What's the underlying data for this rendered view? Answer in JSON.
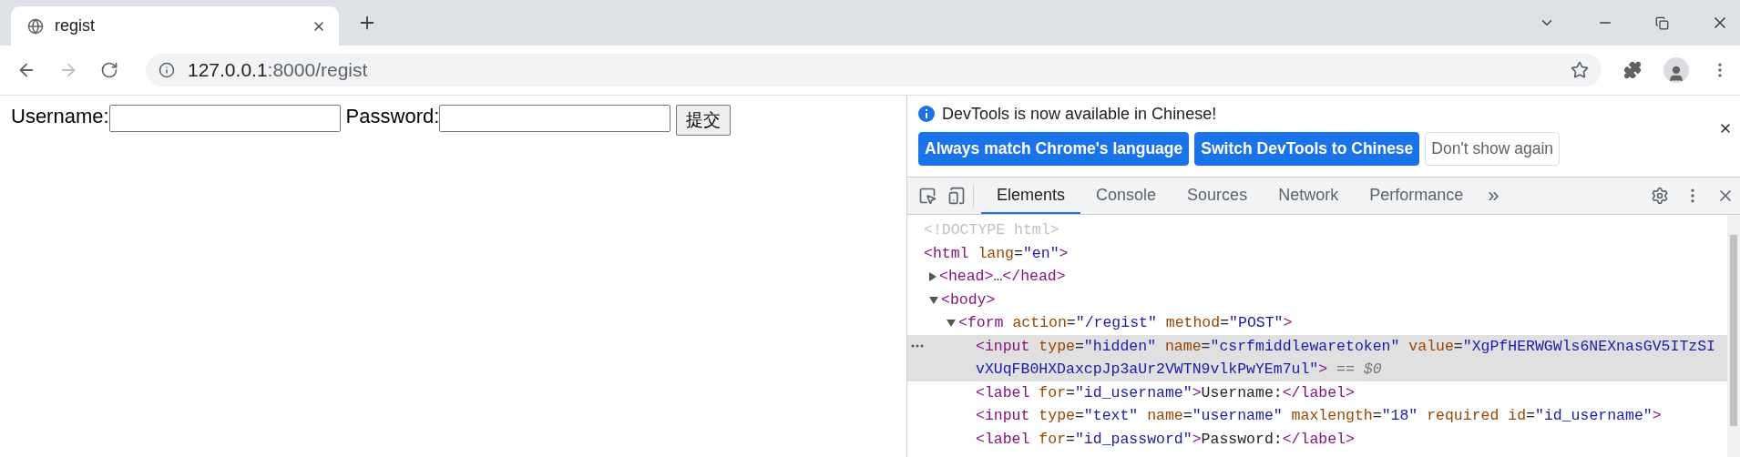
{
  "browser": {
    "tab": {
      "title": "regist"
    },
    "address": {
      "host": "127.0.0.1",
      "rest": ":8000/regist"
    },
    "forward_disabled": true
  },
  "page": {
    "fields": [
      {
        "label": "Username:"
      },
      {
        "label": "Password:"
      }
    ],
    "submit": "提交"
  },
  "devtools": {
    "infobar": {
      "message": "DevTools is now available in Chinese!",
      "buttons": [
        {
          "label": "Always match Chrome's language",
          "kind": "primary"
        },
        {
          "label": "Switch DevTools to Chinese",
          "kind": "primary"
        },
        {
          "label": "Don't show again",
          "kind": "secondary"
        }
      ]
    },
    "tabs": [
      {
        "label": "Elements",
        "selected": true
      },
      {
        "label": "Console",
        "selected": false
      },
      {
        "label": "Sources",
        "selected": false
      },
      {
        "label": "Network",
        "selected": false
      },
      {
        "label": "Performance",
        "selected": false
      }
    ],
    "more_tabs": "»",
    "dom": [
      {
        "selected": false,
        "segments": [
          {
            "kind": "doctype",
            "t": "<!DOCTYPE html>"
          }
        ]
      },
      {
        "selected": false,
        "segments": [
          {
            "kind": "tag",
            "t": "<html"
          },
          {
            "kind": "attr",
            "t": " lang"
          },
          {
            "kind": "plain",
            "t": "="
          },
          {
            "kind": "value",
            "t": "\"en\""
          },
          {
            "kind": "tag",
            "t": ">"
          }
        ],
        "children": [
          {
            "selected": false,
            "expanded": false,
            "segments": [
              {
                "kind": "tag",
                "t": "<head>"
              },
              {
                "kind": "plain",
                "t": "…"
              },
              {
                "kind": "tag",
                "t": "</head>"
              }
            ]
          },
          {
            "selected": false,
            "expanded": true,
            "segments": [
              {
                "kind": "tag",
                "t": "<body>"
              }
            ],
            "children": [
              {
                "selected": false,
                "expanded": true,
                "segments": [
                  {
                    "kind": "tag",
                    "t": "<form"
                  },
                  {
                    "kind": "attr",
                    "t": " action"
                  },
                  {
                    "kind": "plain",
                    "t": "="
                  },
                  {
                    "kind": "value",
                    "t": "\"/regist\""
                  },
                  {
                    "kind": "attr",
                    "t": " method"
                  },
                  {
                    "kind": "plain",
                    "t": "="
                  },
                  {
                    "kind": "value",
                    "t": "\"POST\""
                  },
                  {
                    "kind": "tag",
                    "t": ">"
                  }
                ],
                "children": [
                  {
                    "selected": true,
                    "segments": [
                      {
                        "kind": "tag",
                        "t": "<input"
                      },
                      {
                        "kind": "attr",
                        "t": " type"
                      },
                      {
                        "kind": "plain",
                        "t": "="
                      },
                      {
                        "kind": "value",
                        "t": "\"hidden\""
                      },
                      {
                        "kind": "attr",
                        "t": " name"
                      },
                      {
                        "kind": "plain",
                        "t": "="
                      },
                      {
                        "kind": "value",
                        "t": "\"csrfmiddlewaretoken\""
                      },
                      {
                        "kind": "attr",
                        "t": " value"
                      },
                      {
                        "kind": "plain",
                        "t": "="
                      },
                      {
                        "kind": "value",
                        "t": "\"XgPfHERWGWls6NEXnasGV5ITzSIvXUqFB0HXDaxcpJp3aUr2VWTN9vlkPwYEm7ul\""
                      },
                      {
                        "kind": "tag",
                        "t": ">"
                      },
                      {
                        "kind": "dim",
                        "t": " == $0"
                      }
                    ]
                  },
                  {
                    "selected": false,
                    "segments": [
                      {
                        "kind": "tag",
                        "t": "<label"
                      },
                      {
                        "kind": "attr",
                        "t": " for"
                      },
                      {
                        "kind": "plain",
                        "t": "="
                      },
                      {
                        "kind": "value",
                        "t": "\"id_username\""
                      },
                      {
                        "kind": "tag",
                        "t": ">"
                      },
                      {
                        "kind": "plain",
                        "t": "Username:"
                      },
                      {
                        "kind": "tag",
                        "t": "</label>"
                      }
                    ]
                  },
                  {
                    "selected": false,
                    "segments": [
                      {
                        "kind": "tag",
                        "t": "<input"
                      },
                      {
                        "kind": "attr",
                        "t": " type"
                      },
                      {
                        "kind": "plain",
                        "t": "="
                      },
                      {
                        "kind": "value",
                        "t": "\"text\""
                      },
                      {
                        "kind": "attr",
                        "t": " name"
                      },
                      {
                        "kind": "plain",
                        "t": "="
                      },
                      {
                        "kind": "value",
                        "t": "\"username\""
                      },
                      {
                        "kind": "attr",
                        "t": " maxlength"
                      },
                      {
                        "kind": "plain",
                        "t": "="
                      },
                      {
                        "kind": "value",
                        "t": "\"18\""
                      },
                      {
                        "kind": "attr",
                        "t": " required id"
                      },
                      {
                        "kind": "plain",
                        "t": "="
                      },
                      {
                        "kind": "value",
                        "t": "\"id_username\""
                      },
                      {
                        "kind": "tag",
                        "t": ">"
                      }
                    ]
                  },
                  {
                    "selected": false,
                    "segments": [
                      {
                        "kind": "tag",
                        "t": "<label"
                      },
                      {
                        "kind": "attr",
                        "t": " for"
                      },
                      {
                        "kind": "plain",
                        "t": "="
                      },
                      {
                        "kind": "value",
                        "t": "\"id_password\""
                      },
                      {
                        "kind": "tag",
                        "t": ">"
                      },
                      {
                        "kind": "plain",
                        "t": "Password:"
                      },
                      {
                        "kind": "tag",
                        "t": "</label>"
                      }
                    ]
                  }
                ]
              }
            ]
          }
        ]
      }
    ]
  }
}
